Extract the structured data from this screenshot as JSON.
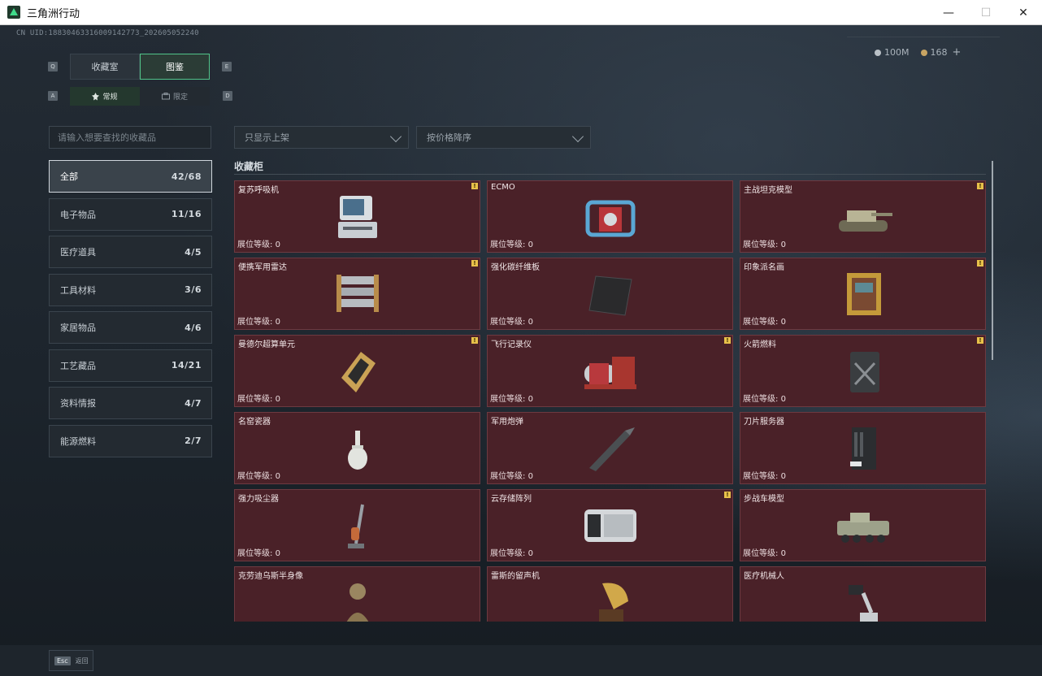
{
  "window": {
    "title": "三角洲行动",
    "min": "—",
    "max": "☐",
    "close": "✕"
  },
  "uid": "CN UID:18830463316009142773_202605052240",
  "currency": {
    "silver": "100M",
    "gold": "168",
    "plus": "+"
  },
  "keys": {
    "q": "Q",
    "e": "E",
    "a": "A",
    "d": "D"
  },
  "main_tabs": [
    {
      "label": "收藏室"
    },
    {
      "label": "图鉴"
    }
  ],
  "sub_tabs": [
    {
      "label": "常规"
    },
    {
      "label": "限定"
    }
  ],
  "search": {
    "placeholder": "请输入想要查找的收藏品"
  },
  "filters": {
    "display": "只显示上架",
    "sort": "按价格降序"
  },
  "categories": [
    {
      "label": "全部",
      "count": "42/68"
    },
    {
      "label": "电子物品",
      "count": "11/16"
    },
    {
      "label": "医疗道具",
      "count": "4/5"
    },
    {
      "label": "工具材料",
      "count": "3/6"
    },
    {
      "label": "家居物品",
      "count": "4/6"
    },
    {
      "label": "工艺藏品",
      "count": "14/21"
    },
    {
      "label": "资料情报",
      "count": "4/7"
    },
    {
      "label": "能源燃料",
      "count": "2/7"
    }
  ],
  "section_title": "收藏柜",
  "level_label": "展位等级:",
  "items": [
    {
      "name": "复苏呼吸机",
      "level": "0",
      "warn": true,
      "icon": "ventilator-icon"
    },
    {
      "name": "ECMO",
      "level": "0",
      "warn": false,
      "icon": "ecmo-icon"
    },
    {
      "name": "主战坦克模型",
      "level": "0",
      "warn": true,
      "icon": "tank-model-icon"
    },
    {
      "name": "便携军用雷达",
      "level": "0",
      "warn": true,
      "icon": "radar-icon"
    },
    {
      "name": "强化碳纤维板",
      "level": "0",
      "warn": false,
      "icon": "carbon-plate-icon"
    },
    {
      "name": "印象派名画",
      "level": "0",
      "warn": true,
      "icon": "painting-icon"
    },
    {
      "name": "曼德尔超算单元",
      "level": "0",
      "warn": true,
      "icon": "supercomputer-unit-icon"
    },
    {
      "name": "飞行记录仪",
      "level": "0",
      "warn": true,
      "icon": "flight-recorder-icon"
    },
    {
      "name": "火箭燃料",
      "level": "0",
      "warn": true,
      "icon": "rocket-fuel-icon"
    },
    {
      "name": "名窑瓷器",
      "level": "0",
      "warn": false,
      "icon": "porcelain-vase-icon"
    },
    {
      "name": "军用炮弹",
      "level": "0",
      "warn": false,
      "icon": "shell-icon"
    },
    {
      "name": "刀片服务器",
      "level": "0",
      "warn": false,
      "icon": "blade-server-icon"
    },
    {
      "name": "强力吸尘器",
      "level": "0",
      "warn": false,
      "icon": "vacuum-icon"
    },
    {
      "name": "云存储阵列",
      "level": "0",
      "warn": true,
      "icon": "storage-array-icon"
    },
    {
      "name": "步战车模型",
      "level": "0",
      "warn": false,
      "icon": "ifv-model-icon"
    },
    {
      "name": "克劳迪乌斯半身像",
      "level": "",
      "warn": false,
      "icon": "bust-icon"
    },
    {
      "name": "雷斯的留声机",
      "level": "",
      "warn": false,
      "icon": "gramophone-icon"
    },
    {
      "name": "医疗机械人",
      "level": "",
      "warn": false,
      "icon": "medical-robot-icon"
    }
  ],
  "bottom": {
    "esc_key": "Esc",
    "esc_label": "返回"
  }
}
